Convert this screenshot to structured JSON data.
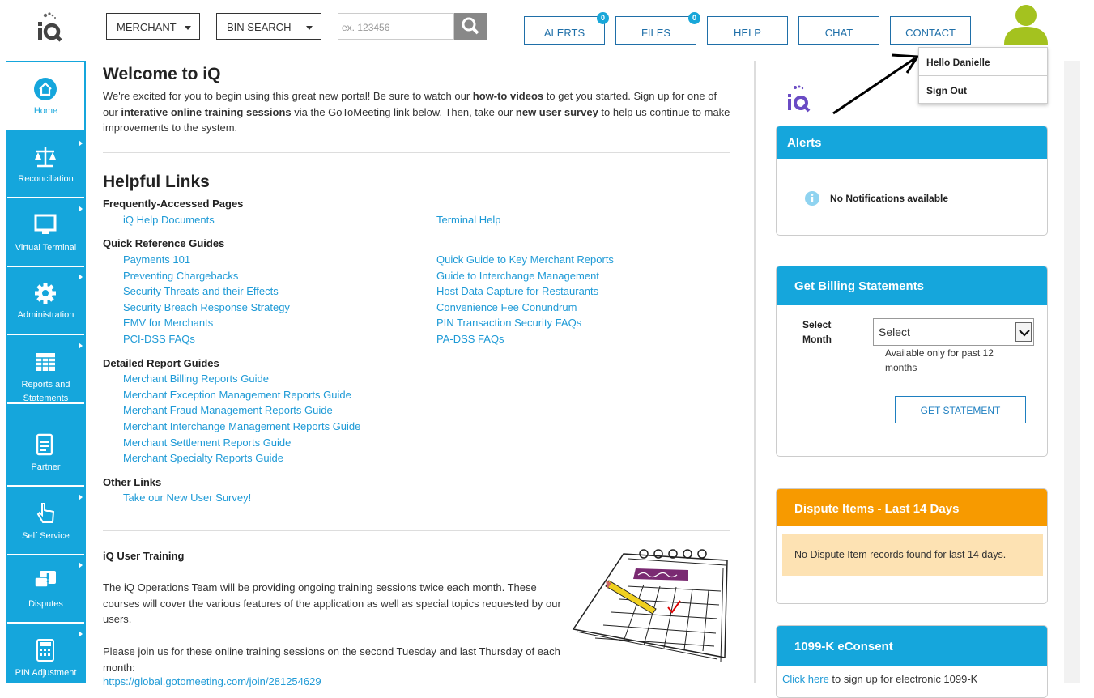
{
  "header": {
    "merchant_label": "MERCHANT",
    "binsearch_label": "BIN SEARCH",
    "search_placeholder": "ex. 123456",
    "nav": [
      {
        "label": "ALERTS",
        "badge": "0"
      },
      {
        "label": "FILES",
        "badge": "0"
      },
      {
        "label": "HELP"
      },
      {
        "label": "CHAT"
      },
      {
        "label": "CONTACT"
      }
    ],
    "user_menu": {
      "greeting": "Hello Danielle",
      "signout": "Sign Out"
    }
  },
  "sidebar": {
    "items": [
      {
        "label": "Home",
        "icon": "home-icon"
      },
      {
        "label": "Reconciliation",
        "icon": "scale-icon"
      },
      {
        "label": "Virtual Terminal",
        "icon": "monitor-icon"
      },
      {
        "label": "Administration",
        "icon": "gear-icon"
      },
      {
        "label": "Reports and Statements",
        "icon": "spreadsheet-icon"
      },
      {
        "label": "Partner",
        "icon": "document-icon"
      },
      {
        "label": "Self Service",
        "icon": "hand-pointer-icon"
      },
      {
        "label": "Disputes",
        "icon": "chat-alert-icon"
      },
      {
        "label": "PIN Adjustment",
        "icon": "calculator-icon"
      }
    ]
  },
  "main": {
    "welcome_title": "Welcome to iQ",
    "intro": {
      "p1": "We're excited for you to begin using this great new portal! Be sure to watch our ",
      "b1": "how-to videos",
      "p2": " to get you started. Sign up for one of our ",
      "b2": "interative online training sessions",
      "p3": " via the GoToMeeting link below. Then, take our ",
      "b3": "new user survey",
      "p4": " to help us continue to make improvements to the system."
    },
    "helpful_title": "Helpful Links",
    "sections": {
      "frequent": {
        "title": "Frequently-Accessed Pages",
        "left": [
          "iQ Help Documents"
        ],
        "right": [
          "Terminal Help"
        ]
      },
      "quick": {
        "title": "Quick Reference Guides",
        "left": [
          "Payments 101",
          "Preventing Chargebacks",
          "Security Threats and their Effects",
          "Security Breach Response Strategy",
          "EMV for Merchants",
          "PCI-DSS FAQs"
        ],
        "right": [
          "Quick Guide to Key Merchant Reports",
          "Guide to Interchange Management",
          "Host Data Capture for Restaurants",
          "Convenience Fee Conundrum",
          "PIN Transaction Security FAQs",
          "PA-DSS FAQs"
        ]
      },
      "detailed": {
        "title": "Detailed Report Guides",
        "left": [
          "Merchant Billing Reports Guide",
          "Merchant Exception Management Reports Guide",
          "Merchant Fraud Management Reports Guide",
          "Merchant Interchange Management Reports Guide",
          "Merchant Settlement Reports Guide",
          "Merchant Specialty Reports Guide"
        ]
      },
      "other": {
        "title": "Other Links",
        "left": [
          "Take our New User Survey!"
        ]
      }
    },
    "training": {
      "title": "iQ User Training",
      "p1": "The iQ Operations Team will be providing ongoing training sessions twice each month. These courses will cover the various features of the application as well as special topics requested by our users.",
      "p2": "Please join us for these online training sessions on the second Tuesday and last Thursday of each month:",
      "link": "https://global.gotomeeting.com/join/281254629"
    }
  },
  "right": {
    "alerts": {
      "title": "Alerts",
      "message": "No Notifications available"
    },
    "billing": {
      "title": "Get Billing Statements",
      "select_label": "Select Month",
      "select_value": "Select",
      "note": "Available only for past 12 months",
      "button": "GET STATEMENT"
    },
    "disputes": {
      "title": "Dispute Items - Last 14 Days",
      "message": "No Dispute Item records found for last 14 days."
    },
    "econsent": {
      "title": "1099-K eConsent",
      "link": "Click here",
      "text": " to sign up for electronic 1099-K"
    }
  },
  "colors": {
    "brand": "#15a6dc",
    "link": "#1e9ad6",
    "orange": "#f79a00",
    "avatar": "#a4c21f"
  }
}
